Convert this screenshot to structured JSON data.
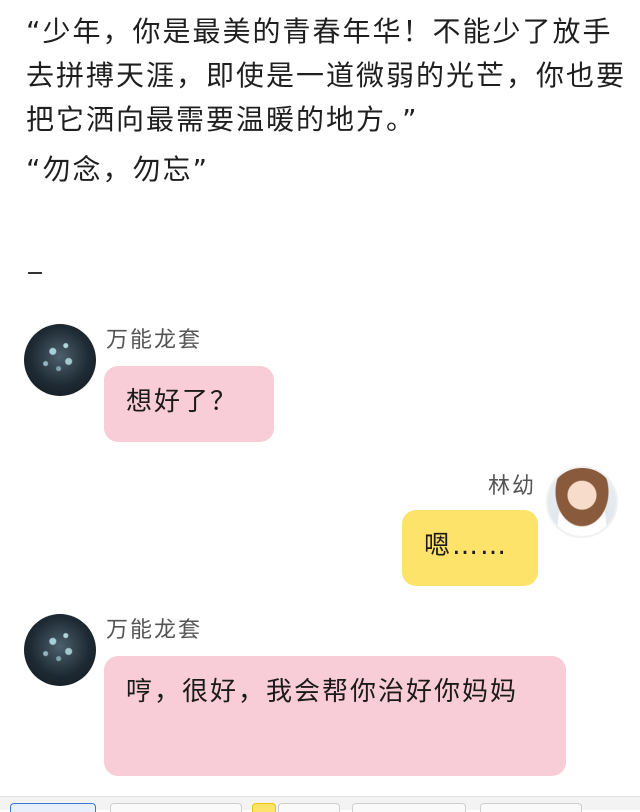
{
  "narrative": {
    "paragraph1": "“少年，你是最美的青春年华！不能少了放手去拼搏天涯，即使是一道微弱的光芒，你也要把它洒向最需要温暖的地方。”",
    "paragraph2": "“勿念，勿忘”"
  },
  "chat": {
    "messages": [
      {
        "sender": "万能龙套",
        "text": "想好了？"
      },
      {
        "sender": "林幼",
        "text": "嗯……"
      },
      {
        "sender": "万能龙套",
        "text": "哼，很好，我会帮你治好你妈妈"
      }
    ]
  },
  "colors": {
    "bubble_left": "#f9cdd7",
    "bubble_right": "#fde36a"
  },
  "icons": {
    "left_avatar": "dark-forest-avatar-icon",
    "right_avatar": "girl-avatar-icon"
  }
}
